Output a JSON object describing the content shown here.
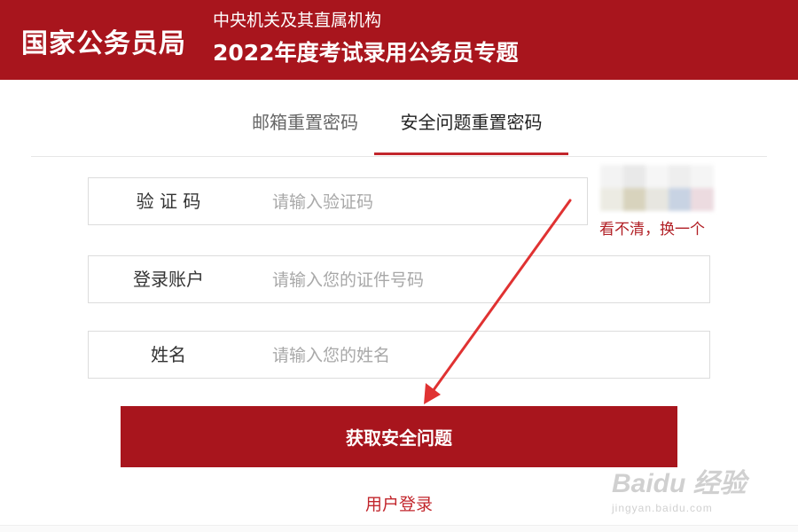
{
  "header": {
    "logo": "国家公务员局",
    "subtitle": "中央机关及其直属机构",
    "title": "2022年度考试录用公务员专题"
  },
  "tabs": [
    {
      "label": "邮箱重置密码",
      "active": false
    },
    {
      "label": "安全问题重置密码",
      "active": true
    }
  ],
  "form": {
    "captcha": {
      "label": "验 证 码",
      "placeholder": "请输入验证码",
      "value": ""
    },
    "account": {
      "label": "登录账户",
      "placeholder": "请输入您的证件号码",
      "value": ""
    },
    "name": {
      "label": "姓名",
      "placeholder": "请输入您的姓名",
      "value": ""
    },
    "captcha_refresh": "看不清，换一个",
    "submit_label": "获取安全问题",
    "login_link": "用户登录"
  },
  "watermark": {
    "text": "Baidu 经验",
    "url": "jingyan.baidu.com"
  },
  "colors": {
    "brand": "#a8151d",
    "accent": "#c2262c",
    "annotation_arrow": "#e03232"
  }
}
